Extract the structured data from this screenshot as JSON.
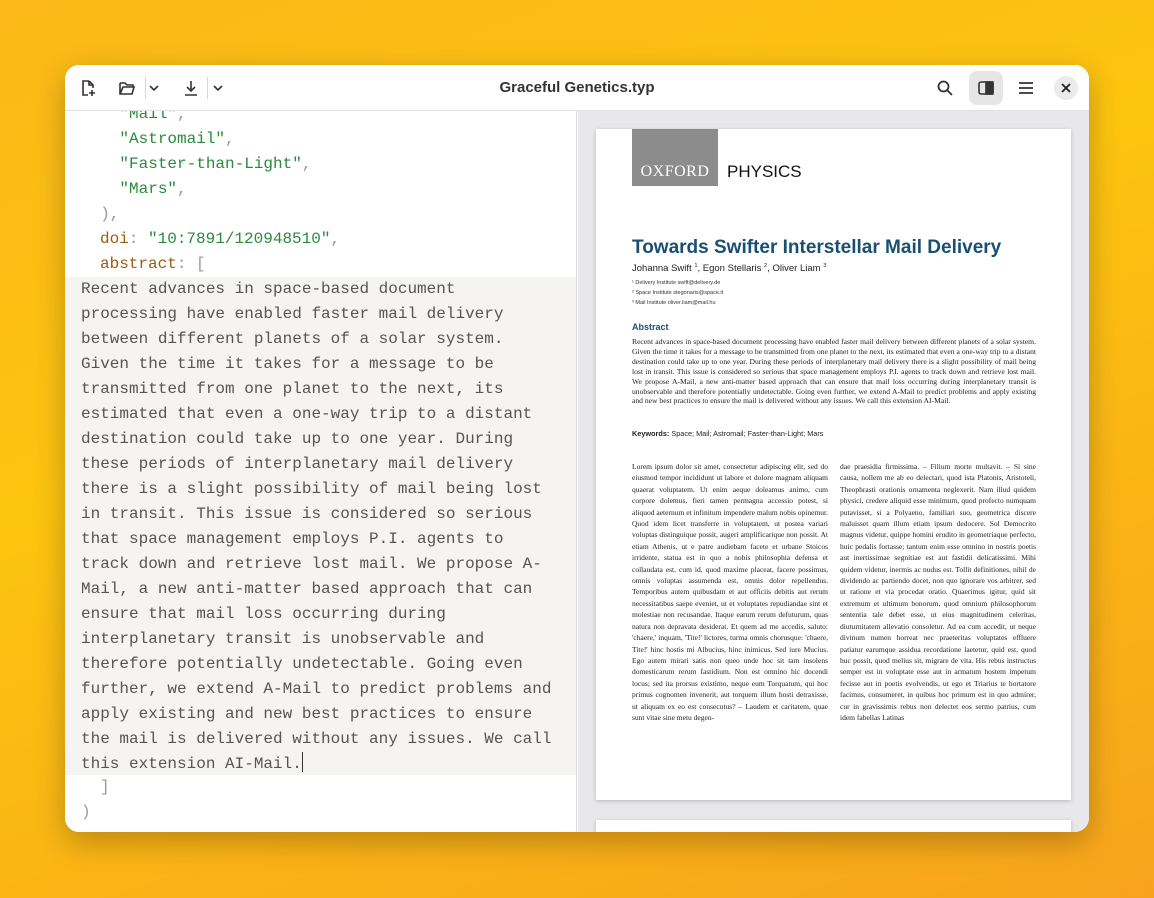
{
  "window": {
    "title": "Graceful Genetics.typ"
  },
  "editor": {
    "lines": [
      {
        "indent": "    ",
        "str": "\"Mail\"",
        "punct": ","
      },
      {
        "indent": "    ",
        "str": "\"Astromail\"",
        "punct": ","
      },
      {
        "indent": "    ",
        "str": "\"Faster-than-Light\"",
        "punct": ","
      },
      {
        "indent": "    ",
        "str": "\"Mars\"",
        "punct": ","
      }
    ],
    "close_paren": "  ),",
    "doi_key": "doi",
    "doi_value": "\"10:7891/120948510\"",
    "abstract_key": "abstract",
    "abstract_open": "[",
    "abstract_text": "Recent advances in space-based document\nprocessing have enabled faster mail delivery\nbetween different planets of a solar system.\nGiven the time it takes for a message to be\ntransmitted from one planet to the next, its\nestimated that even a one-way trip to a distant\ndestination could take up to one year. During\nthese periods of interplanetary mail delivery\nthere is a slight possibility of mail being lost\nin transit. This issue is considered so serious\nthat space management employs P.I. agents to\ntrack down and retrieve lost mail. We propose A-\nMail, a new anti-matter based approach that can\nensure that mail loss occurring during\ninterplanetary transit is unobservable and\ntherefore potentially undetectable. Going even\nfurther, we extend A-Mail to predict problems and\napply existing and new best practices to ensure\nthe mail is delivered without any issues. We call\nthis extension AI-Mail.",
    "close_bracket": "]",
    "final_paren": ")"
  },
  "preview": {
    "logo": "OXFORD",
    "journal": "PHYSICS",
    "title": "Towards Swifter Interstellar Mail Delivery",
    "authors": [
      {
        "name": "Johanna Swift",
        "sup": "1"
      },
      {
        "name": "Egon Stellaris",
        "sup": "2"
      },
      {
        "name": "Oliver Liam",
        "sup": "3"
      }
    ],
    "affiliations": [
      "¹ Delivery Institute swift@delivery.de",
      "² Space Institute stegonaris@space.it",
      "³ Mail Institute oliver.liam@mail.hu"
    ],
    "abstract_heading": "Abstract",
    "abstract": "Recent advances in space-based document processing have enabled faster mail delivery between different planets of a solar system. Given the time it takes for a message to be transmitted from one planet to the next, its estimated that even a one-way trip to a distant destination could take up to one year. During these periods of interplanetary mail delivery there is a slight possibility of mail being lost in transit. This issue is considered so serious that space management employs P.I. agents to track down and retrieve lost mail. We propose A-Mail, a new anti-matter based approach that can ensure that mail loss occurring during interplanetary transit is unobservable and therefore potentially undetectable. Going even further, we extend A-Mail to predict problems and apply existing and new best practices to ensure the mail is delivered without any issues. We call this extension AI-Mail.",
    "keywords_label": "Keywords:",
    "keywords": "Space; Mail; Astromail; Faster-than-Light; Mars",
    "col1": "Lorem ipsum dolor sit amet, consectetur adipiscing elit, sed do eiusmod tempor incididunt ut labore et dolore magnam aliquam quaerat voluptatem. Ut enim aeque doleamus animo, cum corpore dolemus, fieri tamen permagna accessio potest, si aliquod aeternum et infinitum impendere malum nobis opinemur. Quod idem licet transferre in voluptatem, ut postea variari voluptas distinguique possit, augeri amplificarique non possit. At etiam Athenis, ut e patre audiebam facete et urbane Stoicos irridente, statua est in quo a nobis philosophia defensa et collaudata est, cum id, quod maxime placeat, facere possimus, omnis voluptas assumenda est, omnis dolor repellendus. Temporibus autem quibusdam et aut officiis debitis aut rerum necessitatibus saepe eveniet, ut et voluptates repudiandae sint et molestiae non recusandae. Itaque earum rerum defuturum, quas natura non depravata desiderat. Et quem ad me accedis, saluto: 'chaere,' inquam, 'Tite!' lictores, turma omnis chorusque: 'chaere, Tite!' hinc hostis mi Albucius, hinc inimicus. Sed iure Mucius. Ego autem mirari satis non queo unde hoc sit tam insolens domesticarum rerum fastidium. Non est omnino hic docendi locus; sed ita prorsus existimo, neque eum Torquatum, qui hoc primus cognomen invenerit, aut torquem illum hosti detraxisse, ut aliquam ex eo est consecutus? – Laudem et caritatem, quae sunt vitae sine metu degen-",
    "col2": "dae praesidia firmissima. – Filium morte multavit. – Si sine causa, nollem me ab eo delectari, quod ista Platonis, Aristoteli, Theophrasti orationis ornamenta neglexerit. Nam illud quidem physici, credere aliquid esse minimum, quod profecto numquam putavisset, si a Polyaeno, familiari suo, geometrica discere maluisset quam illum etiam ipsum dedocere. Sol Democrito magnus videtur, quippe homini erudito in geometriaque perfecto, huic pedalis fortasse; tantum enim esse omnino in nostris poetis aut inertissimae segnitiae est aut fastidii delicatissimi. Mihi quidem videtur, inermis ac nudus est. Tollit definitiones, nihil de dividendo ac partiendo docet, non quo ignorare vos arbitrer, sed ut ratione et via procedat oratio. Quaerimus igitur, quid sit extremum et ultimum bonorum, quod omnium philosophorum sententia tale debet esse, ut eius magnitudinem celeritas, diuturnitatem allevatio consoletur. Ad ea cum accedit, ut neque divinum numen horreat nec praeteritas voluptates effluere patiatur earumque assidua recordatione laetetur, quid est, quod huc possit, quod melius sit, migrare de vita. His rebus instructus semper est in voluptate esse aut in armatum hostem impetum fecisse aut in poetis evolvendis, ut ego et Triarius te hortatore facimus, consumeret, in quibus hoc primum est in quo admirer, cur in gravissimis rebus non delectet eos sermo patrius, cum idem fabellas Latinas"
  }
}
